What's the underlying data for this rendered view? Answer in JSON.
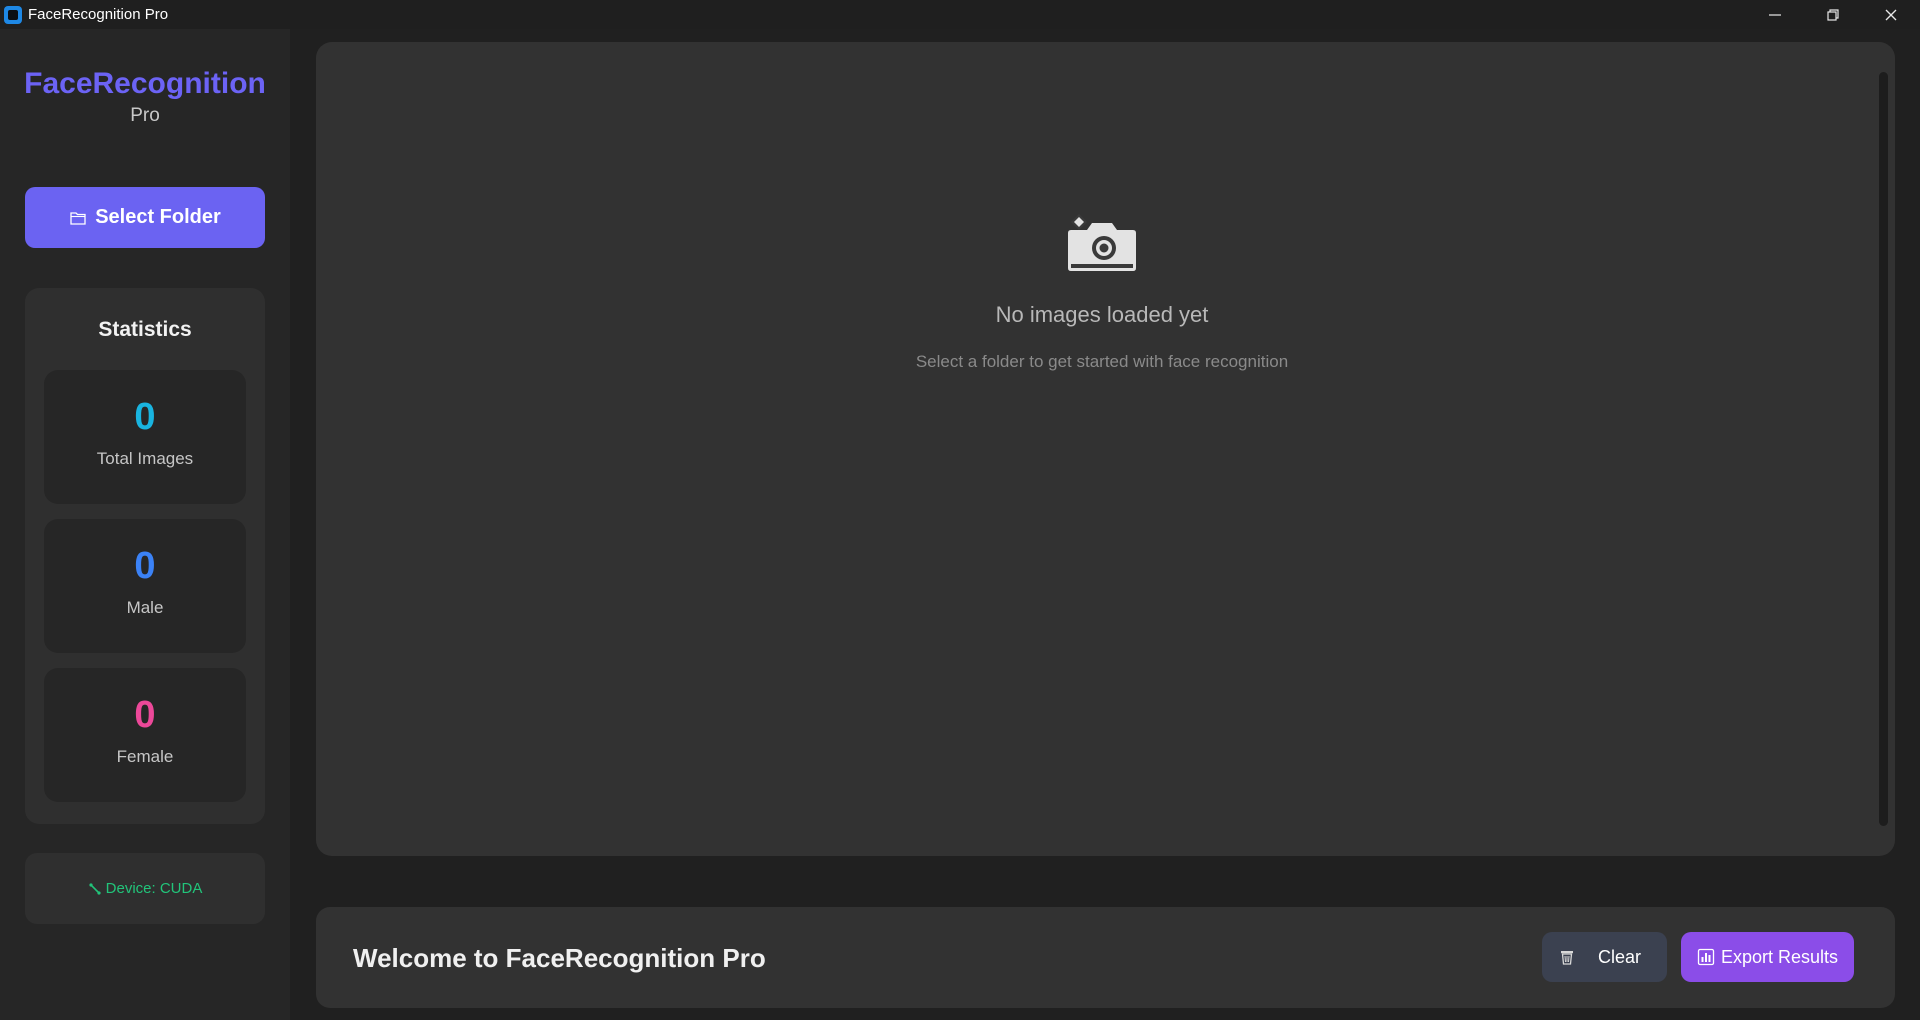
{
  "window": {
    "title": "FaceRecognition Pro",
    "controls": [
      "minimize-icon",
      "restore-icon",
      "close-icon"
    ]
  },
  "sidebar": {
    "brand_name": "FaceRecognition",
    "brand_sub": "Pro",
    "select_folder_label": "Select Folder",
    "select_folder_icon": "folder-icon",
    "statistics": {
      "title": "Statistics",
      "cards": [
        {
          "value": "0",
          "label": "Total Images",
          "color": "#19b4e0"
        },
        {
          "value": "0",
          "label": "Male",
          "color": "#3b82f6"
        },
        {
          "value": "0",
          "label": "Female",
          "color": "#ec4899"
        }
      ]
    },
    "device_label": "Device: CUDA",
    "device_icon": "link-icon"
  },
  "main": {
    "empty_icon": "camera-icon",
    "empty_title": "No images loaded yet",
    "empty_subtitle": "Select a folder to get started with face recognition"
  },
  "footer": {
    "welcome": "Welcome to FaceRecognition Pro",
    "clear_label": "Clear",
    "clear_icon": "trash-icon",
    "export_label": "Export Results",
    "export_icon": "bar-chart-icon"
  },
  "colors": {
    "accent": "#6b63f2",
    "export": "#8b4de8",
    "device_ok": "#22c47a"
  }
}
